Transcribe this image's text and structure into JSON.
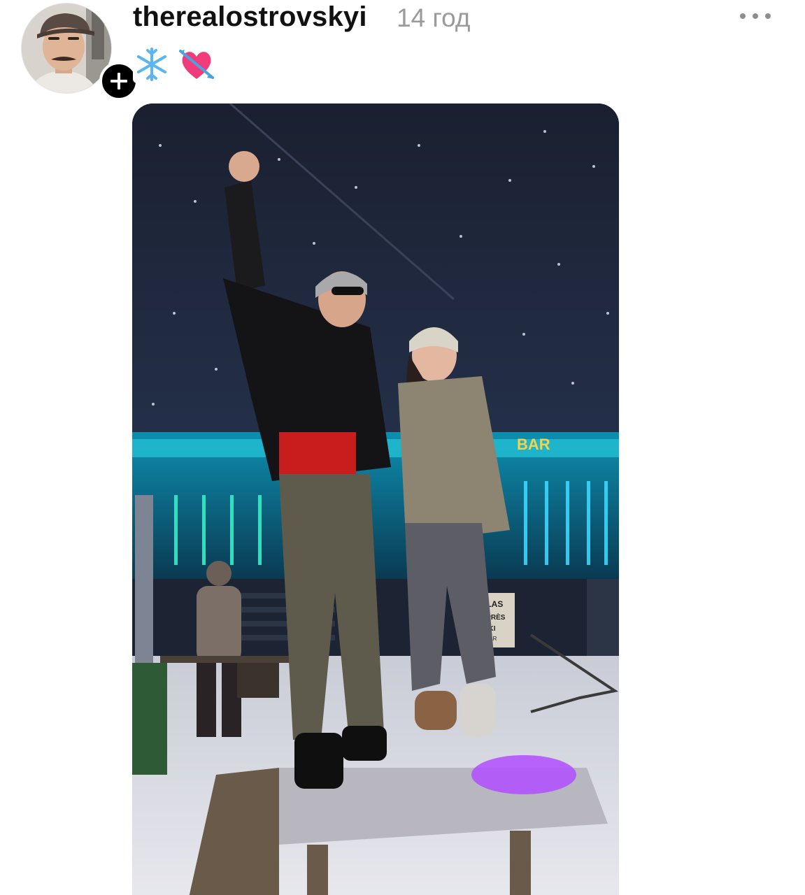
{
  "post": {
    "username": "therealostrovskyi",
    "timestamp": "14 год",
    "caption_emoji": [
      "snowflake-icon",
      "heart-with-arrow-icon"
    ]
  },
  "media": {
    "sign_text": "ATLAS APRÈS SKI BAR"
  },
  "colors": {
    "text_primary": "#111111",
    "text_secondary": "#9a9a9a",
    "follow_button_bg": "#000000",
    "neon_cyan": "#1fe0e6",
    "neon_violet": "#b04dff"
  }
}
